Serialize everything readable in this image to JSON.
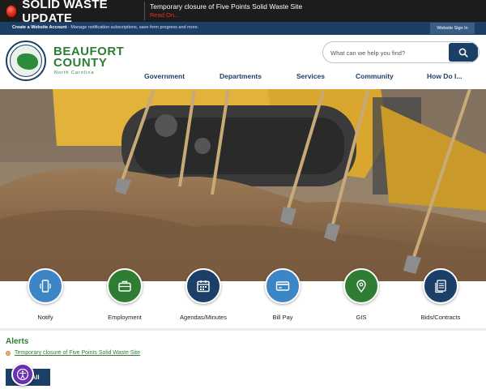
{
  "emergency": {
    "title": "SOLID WASTE UPDATE",
    "message": "Temporary closure of Five Points Solid Waste Site",
    "read_more": "Read On..."
  },
  "utility_bar": {
    "create_account": "Create a Website Account",
    "create_account_rest": " - Manage notification subscriptions, save form progress and more.",
    "sign_in": "Website Sign In"
  },
  "brand": {
    "name_line1": "BEAUFORT",
    "name_line2": "COUNTY",
    "subtitle": "North Carolina"
  },
  "search": {
    "placeholder": "What can we help you find?",
    "icon": "search-icon"
  },
  "nav": {
    "items": [
      {
        "label": "Government"
      },
      {
        "label": "Departments"
      },
      {
        "label": "Services"
      },
      {
        "label": "Community"
      },
      {
        "label": "How Do I..."
      }
    ]
  },
  "quick_links": [
    {
      "label": "Notify",
      "icon": "phone-notify-icon",
      "color": "#3d86c6"
    },
    {
      "label": "Employment",
      "icon": "briefcase-icon",
      "color": "#2e7d32"
    },
    {
      "label": "Agendas/Minutes",
      "icon": "calendar-icon",
      "color": "#1c3f67"
    },
    {
      "label": "Bill Pay",
      "icon": "credit-card-icon",
      "color": "#3d86c6"
    },
    {
      "label": "GIS",
      "icon": "map-pin-icon",
      "color": "#2e7d32"
    },
    {
      "label": "Bids/Contracts",
      "icon": "documents-icon",
      "color": "#1c3f67"
    }
  ],
  "alerts": {
    "title": "Alerts",
    "items": [
      {
        "text": "Temporary closure of Five Points Solid Waste Site"
      }
    ],
    "view_all": "All"
  },
  "colors": {
    "brand_green": "#2e7d32",
    "brand_navy": "#1c3f67",
    "emergency_red": "#e0321f"
  }
}
